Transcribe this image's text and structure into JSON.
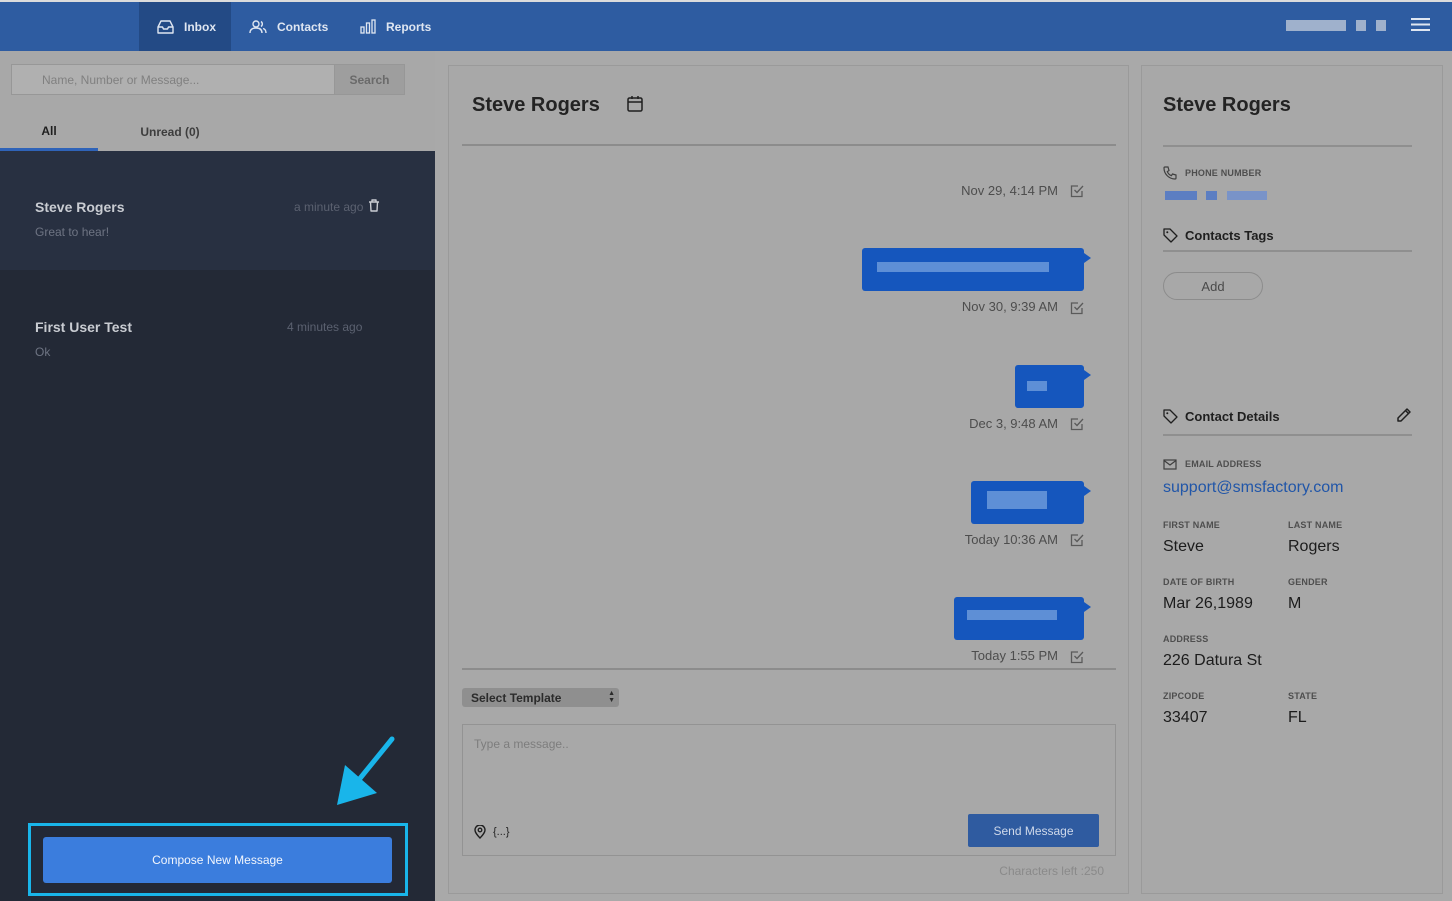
{
  "nav": {
    "tabs": [
      {
        "label": "Inbox",
        "icon": "inbox-icon",
        "active": true
      },
      {
        "label": "Contacts",
        "icon": "contacts-icon"
      },
      {
        "label": "Reports",
        "icon": "reports-icon"
      }
    ],
    "menu_icon": "hamburger-icon"
  },
  "sidebar": {
    "search_placeholder": "Name, Number or Message...",
    "search_button": "Search",
    "tabs": [
      {
        "label": "All",
        "active": true
      },
      {
        "label": "Unread (0)"
      }
    ],
    "conversations": [
      {
        "name": "Steve Rogers",
        "time": "a minute ago",
        "preview": "Great to hear!",
        "active": true
      },
      {
        "name": "First User Test",
        "time": "4 minutes ago",
        "preview": "Ok"
      }
    ],
    "compose_button": "Compose New Message"
  },
  "chat": {
    "title": "Steve Rogers",
    "messages": [
      {
        "time": "Nov 29, 4:14 PM",
        "has_bubble": false
      },
      {
        "time": "Nov 30, 9:39 AM",
        "has_bubble": true
      },
      {
        "time": "Dec 3, 9:48 AM",
        "has_bubble": true
      },
      {
        "time": "Today 10:36 AM",
        "has_bubble": true
      },
      {
        "time": "Today 1:55 PM",
        "has_bubble": true
      }
    ],
    "template_select": "Select Template",
    "message_placeholder": "Type a message..",
    "variables_label": "{...}",
    "send_button": "Send Message",
    "chars_left": "Characters left :250"
  },
  "contact": {
    "name": "Steve Rogers",
    "phone_label": "PHONE NUMBER",
    "tags_title": "Contacts Tags",
    "add_tag_button": "Add",
    "details_title": "Contact Details",
    "email_label": "EMAIL ADDRESS",
    "email": "support@smsfactory.com",
    "first_name_label": "FIRST NAME",
    "first_name": "Steve",
    "last_name_label": "LAST NAME",
    "last_name": "Rogers",
    "dob_label": "DATE OF BIRTH",
    "dob": "Mar 26,1989",
    "gender_label": "GENDER",
    "gender": "M",
    "address_label": "ADDRESS",
    "address": "226 Datura St",
    "zipcode_label": "ZIPCODE",
    "zipcode": "33407",
    "state_label": "STATE",
    "state": "FL"
  },
  "colors": {
    "topbar": "#2e5ca1",
    "sidebar": "#232936",
    "bubble": "#1556bd",
    "compose_button": "#3b7ddd",
    "highlight": "#19b5ea",
    "email_link": "#2156a8"
  }
}
